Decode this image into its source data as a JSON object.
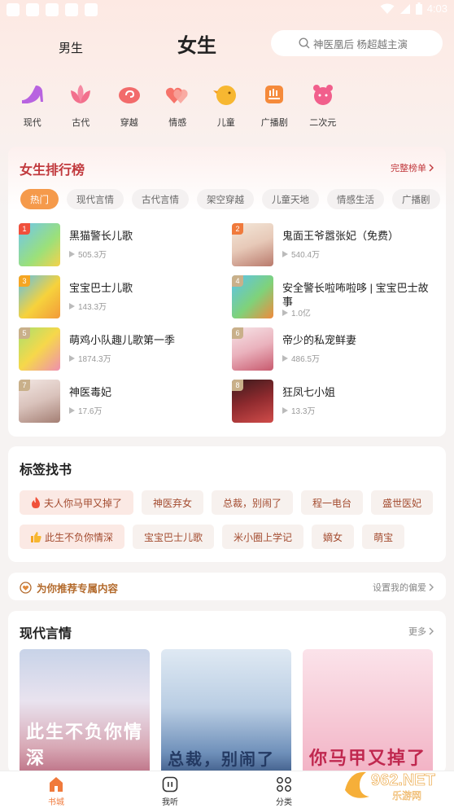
{
  "status_bar": {
    "time": "4:03"
  },
  "header": {
    "tab_male": "男生",
    "tab_female": "女生",
    "search_placeholder": "神医凰后  杨超越主演"
  },
  "categories": [
    {
      "label": "现代",
      "icon": "high-heel-icon",
      "color": "#b863e0"
    },
    {
      "label": "古代",
      "icon": "lotus-icon",
      "color": "#f2708d"
    },
    {
      "label": "穿越",
      "icon": "swirl-cloud-icon",
      "color": "#f26b6b"
    },
    {
      "label": "情感",
      "icon": "hearts-icon",
      "color": "#f6736a"
    },
    {
      "label": "儿童",
      "icon": "chick-icon",
      "color": "#f7b731"
    },
    {
      "label": "广播剧",
      "icon": "radio-icon",
      "color": "#f58a3b"
    },
    {
      "label": "二次元",
      "icon": "anime-face-icon",
      "color": "#f15f8c"
    }
  ],
  "ranking": {
    "title": "女生排行榜",
    "more": "完整榜单",
    "chips": [
      "热门",
      "现代言情",
      "古代言情",
      "架空穿越",
      "儿童天地",
      "情感生活",
      "广播剧"
    ],
    "items": [
      {
        "rank": "1",
        "name": "黑猫警长儿歌",
        "plays": "505.3万"
      },
      {
        "rank": "2",
        "name": "鬼面王爷嚣张妃（免费）",
        "plays": "540.4万"
      },
      {
        "rank": "3",
        "name": "宝宝巴士儿歌",
        "plays": "143.3万"
      },
      {
        "rank": "4",
        "name": "安全警长啦咘啦哆 | 宝宝巴士故事",
        "plays": "1.0亿"
      },
      {
        "rank": "5",
        "name": "萌鸡小队趣儿歌第一季",
        "plays": "1874.3万"
      },
      {
        "rank": "6",
        "name": "帝少的私宠鲜妻",
        "plays": "486.5万"
      },
      {
        "rank": "7",
        "name": "神医毒妃",
        "plays": "17.6万"
      },
      {
        "rank": "8",
        "name": "狂凤七小姐",
        "plays": "13.3万"
      }
    ]
  },
  "tags": {
    "title": "标签找书",
    "row1": [
      "夫人你马甲又掉了",
      "神医弃女",
      "总裁，别闹了",
      "程一电台",
      "盛世医妃"
    ],
    "row2": [
      "此生不负你情深",
      "宝宝巴士儿歌",
      "米小圈上学记",
      "嫡女",
      "萌宝"
    ]
  },
  "recommend": {
    "label": "为你推荐专属内容",
    "action": "设置我的偏爱"
  },
  "romance": {
    "title": "现代言情",
    "more": "更多",
    "covers": [
      "此生不负你情深",
      "总裁，别闹了",
      "你马甲又掉了"
    ]
  },
  "bottom_nav": {
    "books": "书城",
    "listen": "我听",
    "category": "分类"
  },
  "watermark": {
    "brand": "962.NET",
    "sub": "乐游网"
  },
  "colors": {
    "accent": "#f59a4b",
    "rank_red": "#c1393d",
    "tag_text": "#a34b2f"
  }
}
